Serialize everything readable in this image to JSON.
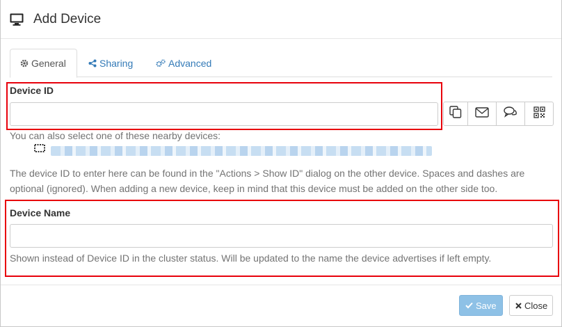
{
  "dialog": {
    "title": "Add Device",
    "icon": "desktop-icon"
  },
  "tabs": [
    {
      "label": "General",
      "icon": "gear-icon",
      "active": true
    },
    {
      "label": "Sharing",
      "icon": "share-icon",
      "active": false
    },
    {
      "label": "Advanced",
      "icon": "gears-icon",
      "active": false
    }
  ],
  "device_id": {
    "label": "Device ID",
    "value": "",
    "nearby_text": "You can also select one of these nearby devices:",
    "help": "The device ID to enter here can be found in the \"Actions > Show ID\" dialog on the other device. Spaces and dashes are optional (ignored). When adding a new device, keep in mind that this device must be added on the other side too.",
    "actions": [
      "copy-icon",
      "envelope-icon",
      "chat-icon",
      "qrcode-icon"
    ]
  },
  "device_name": {
    "label": "Device Name",
    "value": "",
    "help": "Shown instead of Device ID in the cluster status. Will be updated to the name the device advertises if left empty."
  },
  "footer": {
    "save_label": "Save",
    "close_label": "Close"
  },
  "colors": {
    "link": "#337ab7",
    "highlight": "#e8000b",
    "save_bg": "#8ec1e6"
  }
}
